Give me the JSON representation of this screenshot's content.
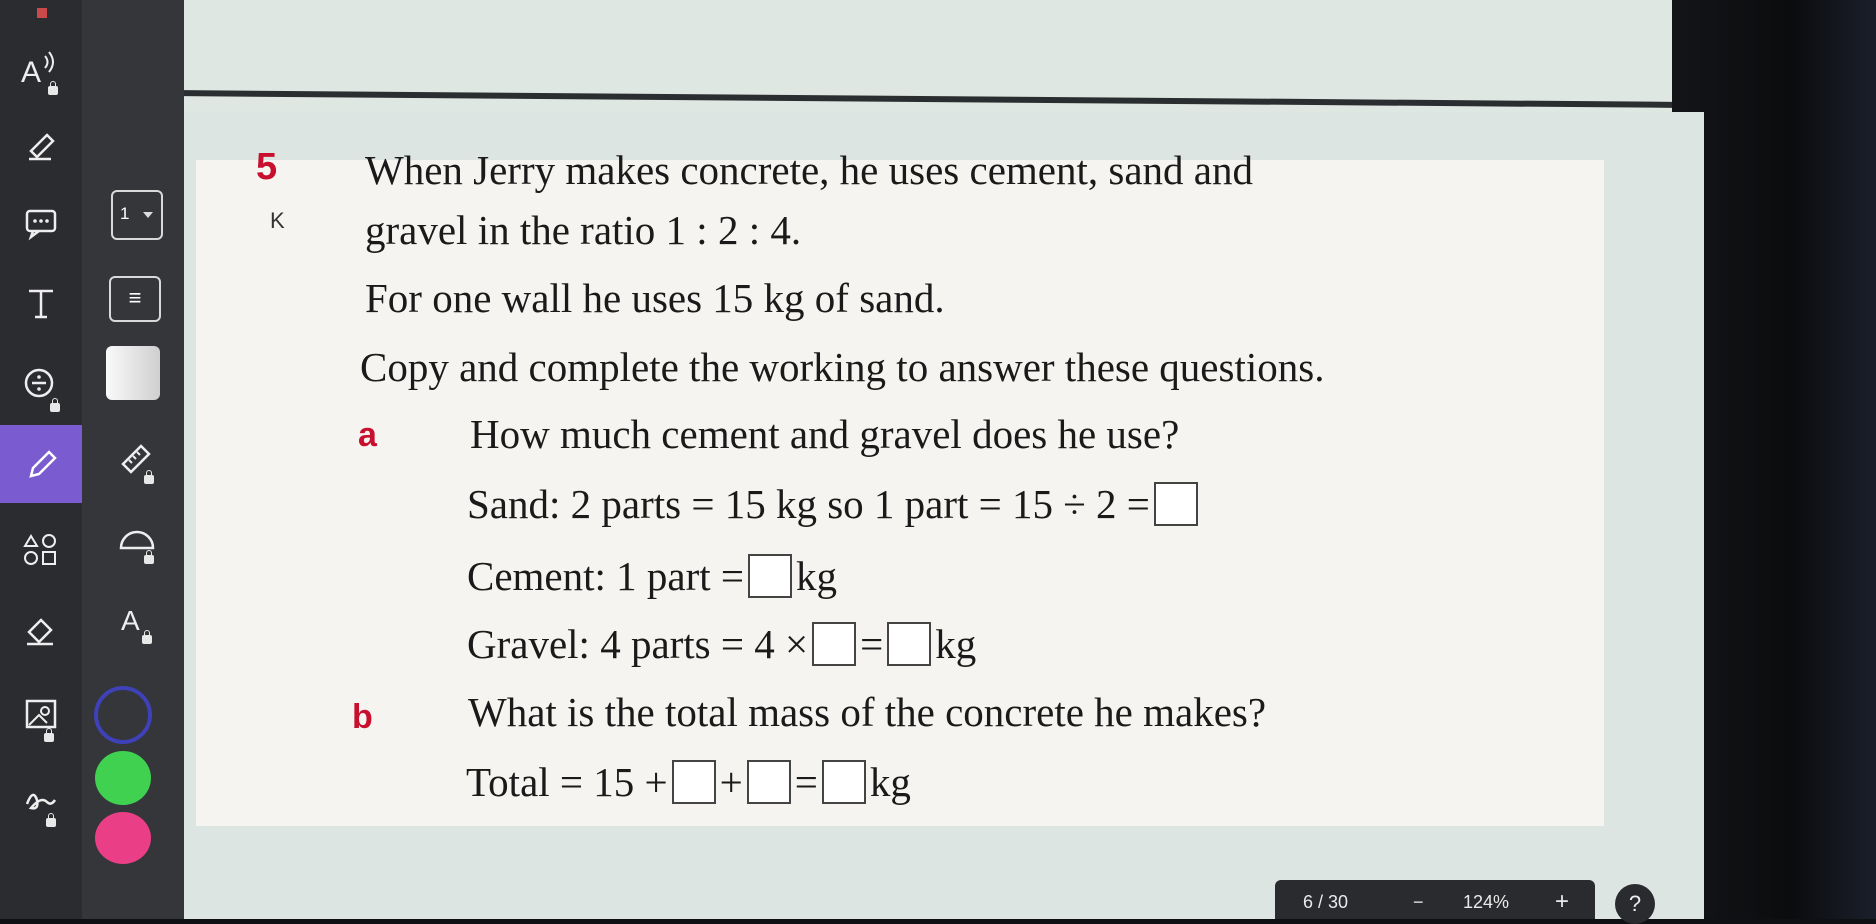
{
  "toolbar": {
    "page_selector_value": "1",
    "lines_icon_glyph": "≡",
    "tools": [
      "text-to-speech-icon",
      "highlighter-icon",
      "comment-icon",
      "text-icon",
      "calculator-icon",
      "pencil-icon",
      "shapes-icon",
      "eraser-icon",
      "image-icon",
      "signature-icon"
    ],
    "secondary_tools": [
      "ruler-icon",
      "protractor-icon",
      "font-size-icon"
    ],
    "colors": {
      "ring": "#3f41b8",
      "green": "#3fd14f",
      "pink": "#ea3f87",
      "active_tool": "#7b5bd0"
    }
  },
  "question": {
    "number": "5",
    "k_mark": "K",
    "line1": "When Jerry makes concrete, he uses cement, sand and",
    "line2": "gravel in the ratio 1 : 2 : 4.",
    "line3": "For one wall he uses 15 kg of sand.",
    "line4": "Copy and complete the working to answer these questions.",
    "part_a": {
      "letter": "a",
      "prompt": "How much cement and gravel does he use?",
      "sand": "Sand: 2 parts = 15 kg so 1 part = 15 ÷ 2 =",
      "cement_pre": "Cement: 1 part =",
      "cement_post": "kg",
      "gravel_pre": "Gravel: 4 parts = 4 ×",
      "gravel_mid": "=",
      "gravel_post": "kg"
    },
    "part_b": {
      "letter": "b",
      "prompt": "What is the total mass of the concrete he makes?",
      "total_pre": "Total = 15 +",
      "plus": "+",
      "equals": "=",
      "total_post": "kg"
    }
  },
  "status_bar": {
    "page_indicator": "6 / 30",
    "zoom_out": "−",
    "zoom_level": "124%",
    "zoom_in": "+",
    "help": "?"
  }
}
